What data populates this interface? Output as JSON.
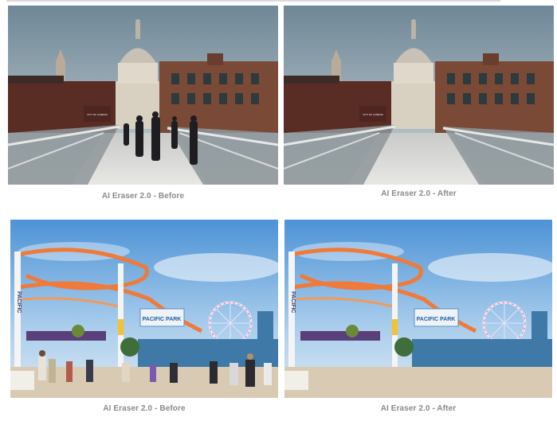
{
  "panels": [
    {
      "caption": "AI Eraser 2.0 - Before",
      "scene": "london",
      "people": true,
      "sign": "CITY OF LONDON"
    },
    {
      "caption": "AI Eraser 2.0 - After",
      "scene": "london",
      "people": false,
      "sign": "CITY OF LONDON"
    },
    {
      "caption": "AI Eraser 2.0 - Before",
      "scene": "pier",
      "people": true,
      "sign": "PACIFIC PARK"
    },
    {
      "caption": "AI Eraser 2.0 - After",
      "scene": "pier",
      "people": false,
      "sign": "PACIFIC PARK"
    }
  ]
}
